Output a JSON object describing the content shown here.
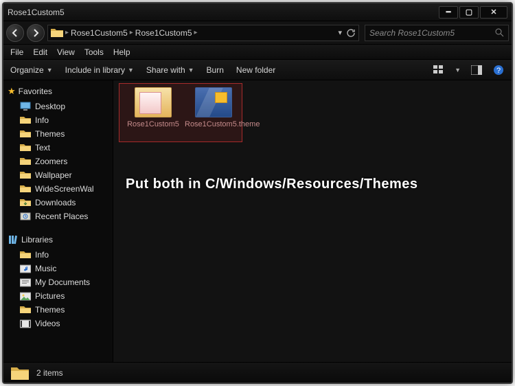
{
  "window": {
    "title": "Rose1Custom5"
  },
  "breadcrumb": {
    "items": [
      "Rose1Custom5",
      "Rose1Custom5"
    ]
  },
  "search": {
    "placeholder": "Search Rose1Custom5"
  },
  "menu": {
    "file": "File",
    "edit": "Edit",
    "view": "View",
    "tools": "Tools",
    "help": "Help"
  },
  "toolbar": {
    "organize": "Organize",
    "include": "Include in library",
    "share": "Share with",
    "burn": "Burn",
    "newfolder": "New folder"
  },
  "sidebar": {
    "favorites_label": "Favorites",
    "favorites": [
      {
        "label": "Desktop",
        "icon": "monitor"
      },
      {
        "label": "Info",
        "icon": "folder"
      },
      {
        "label": "Themes",
        "icon": "folder"
      },
      {
        "label": "Text",
        "icon": "folder"
      },
      {
        "label": "Zoomers",
        "icon": "folder"
      },
      {
        "label": "Wallpaper",
        "icon": "folder"
      },
      {
        "label": "WideScreenWal",
        "icon": "folder"
      },
      {
        "label": "Downloads",
        "icon": "download"
      },
      {
        "label": "Recent Places",
        "icon": "recent"
      }
    ],
    "libraries_label": "Libraries",
    "libraries": [
      {
        "label": "Info",
        "icon": "folder"
      },
      {
        "label": "Music",
        "icon": "music"
      },
      {
        "label": "My Documents",
        "icon": "doc"
      },
      {
        "label": "Pictures",
        "icon": "pic"
      },
      {
        "label": "Themes",
        "icon": "folder"
      },
      {
        "label": "Videos",
        "icon": "video"
      }
    ]
  },
  "content": {
    "items": [
      {
        "name": "Rose1Custom5",
        "type": "folder"
      },
      {
        "name": "Rose1Custom5.theme",
        "type": "theme"
      }
    ],
    "instruction": "Put both in C/Windows/Resources/Themes"
  },
  "status": {
    "count": "2 items"
  }
}
